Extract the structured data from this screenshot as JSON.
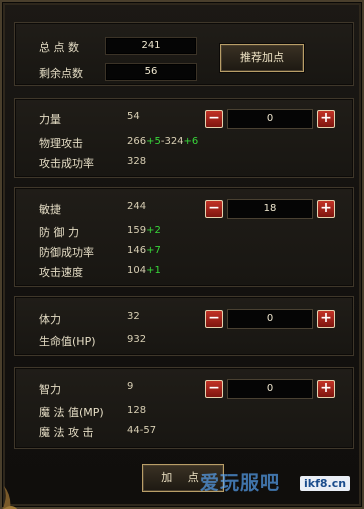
{
  "summary": {
    "total_points_label": "总 点 数",
    "total_points_value": "241",
    "remaining_points_label": "剩余点数",
    "remaining_points_value": "56",
    "recommend_button": "推荐加点"
  },
  "strength": {
    "label": "力量",
    "value": "54",
    "alloc": "0",
    "rows": [
      {
        "label": "物理攻击",
        "base": "266",
        "bonus": "+5",
        "range_sep": "-324",
        "bonus2": "+6"
      },
      {
        "label": "攻击成功率",
        "base": "328"
      }
    ]
  },
  "agility": {
    "label": "敏捷",
    "value": "244",
    "alloc": "18",
    "rows": [
      {
        "label": "防 御 力",
        "base": "159",
        "bonus": "+2"
      },
      {
        "label": "防御成功率",
        "base": "146",
        "bonus": "+7"
      },
      {
        "label": "攻击速度",
        "base": "104",
        "bonus": "+1"
      }
    ]
  },
  "vitality": {
    "label": "体力",
    "value": "32",
    "alloc": "0",
    "rows": [
      {
        "label": "生命值(HP)",
        "base": "932"
      }
    ]
  },
  "intelligence": {
    "label": "智力",
    "value": "9",
    "alloc": "0",
    "rows": [
      {
        "label": "魔 法 值(MP)",
        "base": "128"
      },
      {
        "label": "魔 法 攻 击",
        "base": "44-57"
      }
    ]
  },
  "add_button": "加 点",
  "watermark": {
    "text": "爱玩服吧",
    "sub": "ikf8.cn"
  },
  "colors": {
    "bonus": "#38d63a",
    "accent_red": "#c23327",
    "border_gold": "#b89e68"
  },
  "icons": {
    "minus": "−",
    "plus": "+"
  }
}
